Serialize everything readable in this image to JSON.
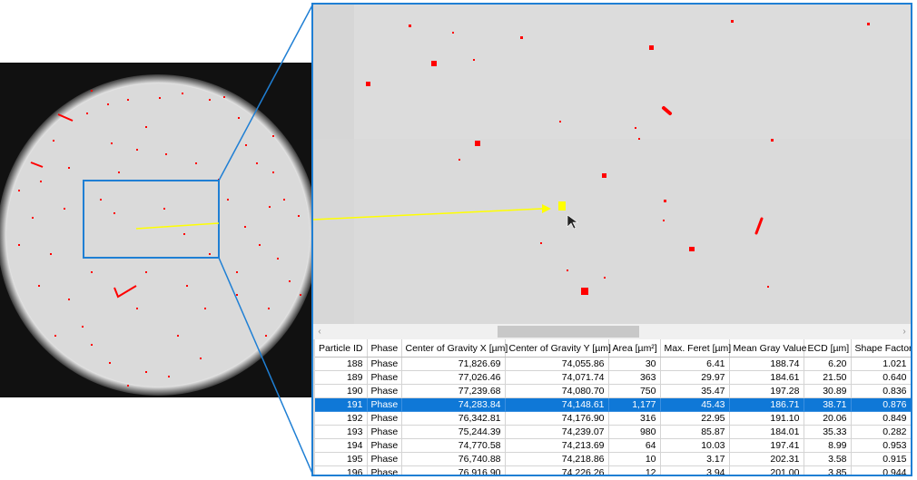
{
  "table": {
    "headers": [
      "Particle ID",
      "Phase",
      "Center of Gravity X [µm]",
      "Center of Gravity Y [µm]",
      "Area [µm²]",
      "Max. Feret [µm]",
      "Mean Gray Value",
      "ECD [µm]",
      "Shape Factor"
    ],
    "rows": [
      [
        "188",
        "Phase",
        "71,826.69",
        "74,055.86",
        "30",
        "6.41",
        "188.74",
        "6.20",
        "1.021"
      ],
      [
        "189",
        "Phase",
        "77,026.46",
        "74,071.74",
        "363",
        "29.97",
        "184.61",
        "21.50",
        "0.640"
      ],
      [
        "190",
        "Phase",
        "77,239.68",
        "74,080.70",
        "750",
        "35.47",
        "197.28",
        "30.89",
        "0.836"
      ],
      [
        "191",
        "Phase",
        "74,283.84",
        "74,148.61",
        "1,177",
        "45.43",
        "186.71",
        "38.71",
        "0.876"
      ],
      [
        "192",
        "Phase",
        "76,342.81",
        "74,176.90",
        "316",
        "22.95",
        "191.10",
        "20.06",
        "0.849"
      ],
      [
        "193",
        "Phase",
        "75,244.39",
        "74,239.07",
        "980",
        "85.87",
        "184.01",
        "35.33",
        "0.282"
      ],
      [
        "194",
        "Phase",
        "74,770.58",
        "74,213.69",
        "64",
        "10.03",
        "197.41",
        "8.99",
        "0.953"
      ],
      [
        "195",
        "Phase",
        "76,740.88",
        "74,218.86",
        "10",
        "3.17",
        "202.31",
        "3.58",
        "0.915"
      ],
      [
        "196",
        "Phase",
        "76,916.90",
        "74,226.26",
        "12",
        "3.94",
        "201.00",
        "3.85",
        "0.944"
      ]
    ],
    "selected_row_index": 3
  },
  "scrollbar": {
    "left_arrow": "‹",
    "right_arrow": "›"
  },
  "colors": {
    "highlight": "#0f78d7",
    "frame": "#1f7fd4",
    "particle": "#ff0000",
    "pointer_arrow": "#ffff00"
  }
}
